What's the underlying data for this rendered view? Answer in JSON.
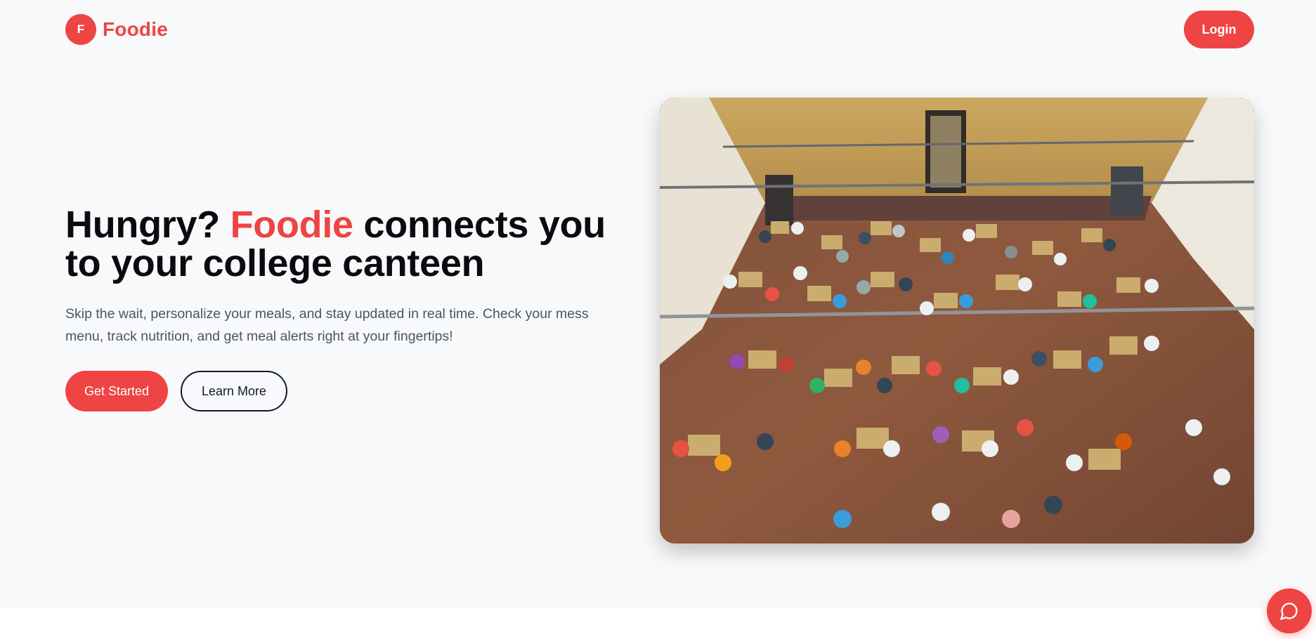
{
  "brand": {
    "logo_letter": "F",
    "name": "Foodie",
    "accent_color": "#ef4444"
  },
  "header": {
    "login_label": "Login"
  },
  "hero": {
    "title_part1": "Hungry? ",
    "title_accent": "Foodie",
    "title_part2": " connects you to your college canteen",
    "description": "Skip the wait, personalize your meals, and stay updated in real time. Check your mess menu, track nutrition, and get meal alerts right at your fingertips!",
    "primary_cta": "Get Started",
    "secondary_cta": "Learn More"
  },
  "icons": {
    "chat": "chat-bubble-icon"
  }
}
